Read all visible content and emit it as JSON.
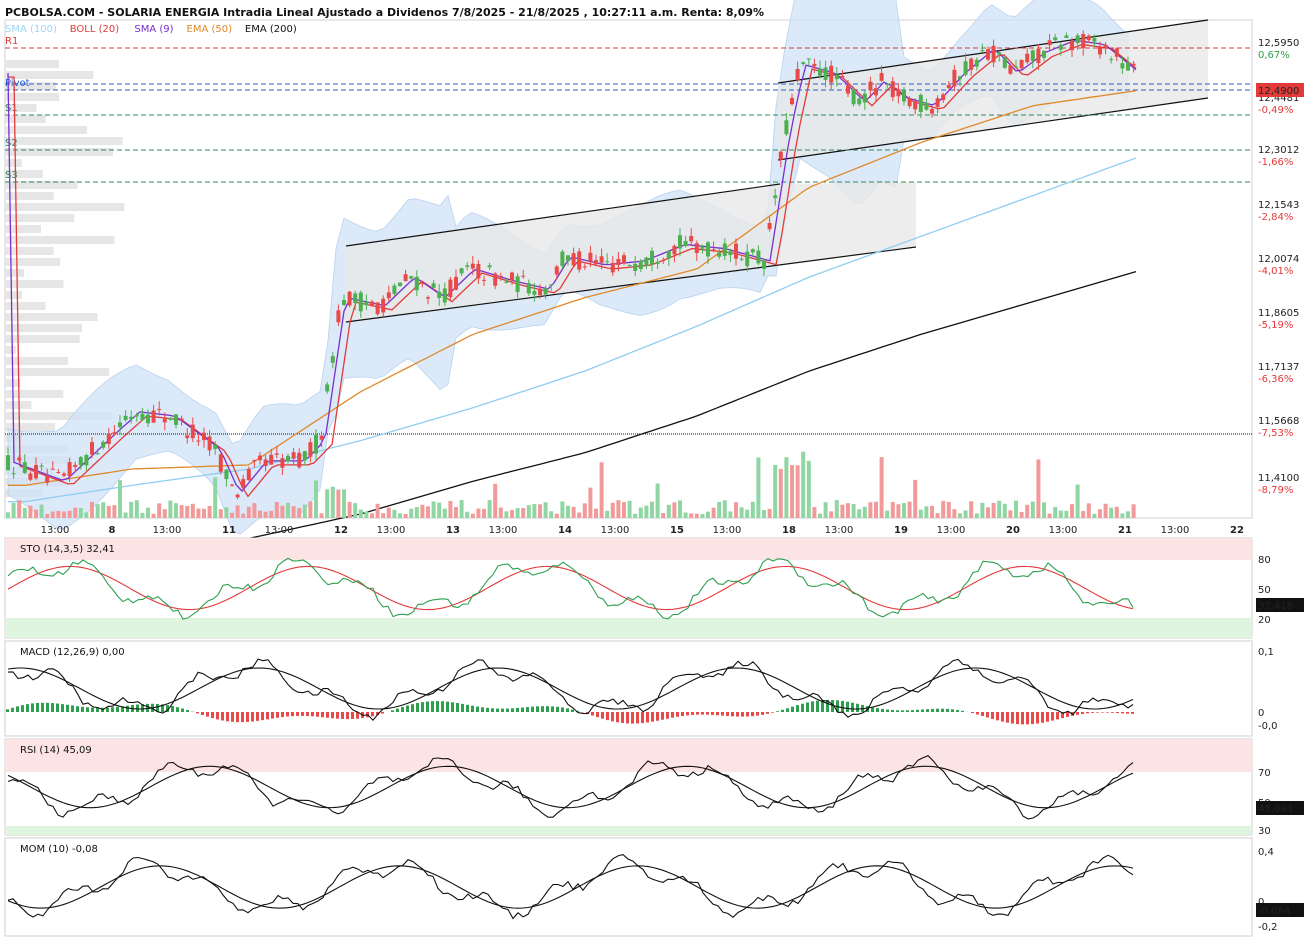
{
  "header": {
    "title": "PCBOLSA.COM - SOLARIA ENERGIA Intradia Lineal Ajustado a Dividenos 7/8/2025 - 21/8/2025 , 10:27:11 a.m. Renta: 8,09%",
    "legend": [
      {
        "label": "SMA (100)",
        "color": "#9fd4f5"
      },
      {
        "label": "BOLL (20)",
        "color": "#e23a3a"
      },
      {
        "label": "SMA (9)",
        "color": "#7a2fd0"
      },
      {
        "label": "EMA (50)",
        "color": "#e0892a"
      },
      {
        "label": "EMA (200)",
        "color": "#111111"
      }
    ]
  },
  "colors": {
    "up": "#4caf50",
    "down": "#e84a4a",
    "boll_fill": "#cfe2f7",
    "sma100": "#8fcdf3",
    "sma9": "#7a2fd0",
    "boll_mid": "#e23a3a",
    "ema50": "#e0892a",
    "ema200": "#111111",
    "pivot": "#2b5fd0",
    "r1": "#e23a3a",
    "support": "#2e8b57"
  },
  "pivots": [
    {
      "label": "R1",
      "value": 12.595
    },
    {
      "label": "Pivot",
      "value": 12.49
    },
    {
      "label": "S1",
      "value": 12.42
    },
    {
      "label": "S2",
      "value": 12.3
    },
    {
      "label": "S3",
      "value": 12.2
    }
  ],
  "price_axis": [
    {
      "value": "12,5950",
      "pct": "0,67%"
    },
    {
      "value": "12,4481",
      "pct": "-0,49%"
    },
    {
      "value": "12,3012",
      "pct": "-1,66%"
    },
    {
      "value": "12,1543",
      "pct": "-2,84%"
    },
    {
      "value": "12,0074",
      "pct": "-4,01%"
    },
    {
      "value": "11,8605",
      "pct": "-5,19%"
    },
    {
      "value": "11,7137",
      "pct": "-6,36%"
    },
    {
      "value": "11,5668",
      "pct": "-7,53%"
    },
    {
      "value": "11,4100",
      "pct": "-8,79%"
    }
  ],
  "last_price": "12,4900",
  "x_axis": [
    "13:00",
    "8",
    "13:00",
    "11",
    "13:00",
    "12",
    "13:00",
    "13",
    "13:00",
    "14",
    "13:00",
    "15",
    "13:00",
    "18",
    "13:00",
    "19",
    "13:00",
    "20",
    "13:00",
    "21",
    "13:00",
    "22"
  ],
  "chart_data": [
    {
      "type": "line",
      "title": "SOLARIA ENERGIA Intradia",
      "ylim": [
        11.41,
        12.63
      ],
      "x": [
        "7/8",
        "8/8",
        "11/8",
        "12/8",
        "13/8",
        "14/8",
        "15/8",
        "18/8",
        "19/8",
        "20/8",
        "21/8"
      ],
      "series": [
        {
          "name": "Close",
          "values": [
            11.47,
            11.66,
            11.52,
            11.95,
            11.94,
            12.05,
            12.07,
            12.49,
            12.44,
            12.57,
            12.49
          ]
        },
        {
          "name": "SMA (100)",
          "values": [
            11.45,
            11.49,
            11.53,
            11.6,
            11.68,
            11.77,
            11.88,
            12.0,
            12.1,
            12.2,
            12.3
          ]
        },
        {
          "name": "EMA (200)",
          "values": [
            11.3,
            11.33,
            11.36,
            11.42,
            11.5,
            11.57,
            11.66,
            11.77,
            11.86,
            11.94,
            12.02
          ]
        },
        {
          "name": "EMA (50)",
          "values": [
            11.49,
            11.53,
            11.54,
            11.72,
            11.86,
            11.95,
            12.02,
            12.22,
            12.33,
            12.42,
            12.46
          ]
        },
        {
          "name": "SMA (9)",
          "values": [
            11.49,
            11.63,
            11.51,
            11.9,
            11.98,
            12.03,
            12.05,
            12.47,
            12.43,
            12.52,
            12.55
          ]
        }
      ]
    },
    {
      "type": "line",
      "title": "STO (14,3,5)",
      "value_label": "32,41",
      "last": "32,418",
      "levels": [
        "80",
        "50",
        "20"
      ],
      "ylim": [
        0,
        100
      ]
    },
    {
      "type": "bar",
      "title": "MACD (12,26,9)",
      "value_label": "0,00",
      "levels": [
        "0,1",
        "0",
        "-0,0"
      ],
      "ylim": [
        -0.02,
        0.11
      ]
    },
    {
      "type": "line",
      "title": "RSI (14)",
      "value_label": "45,09",
      "last": "45,094",
      "levels": [
        "70",
        "50",
        "30"
      ],
      "ylim": [
        25,
        90
      ]
    },
    {
      "type": "line",
      "title": "MOM (10)",
      "value_label": "-0,08",
      "last": "-0,084",
      "levels": [
        "0,4",
        "0",
        "-0,2"
      ],
      "ylim": [
        -0.25,
        0.45
      ]
    }
  ]
}
